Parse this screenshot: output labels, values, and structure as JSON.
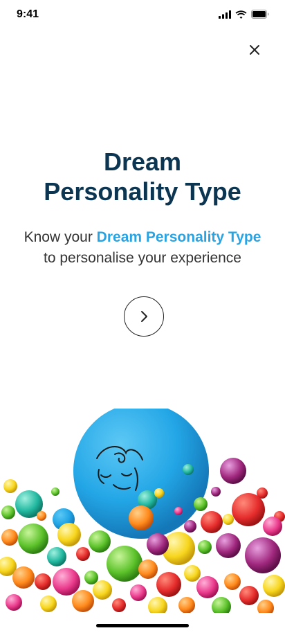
{
  "status_bar": {
    "time": "9:41"
  },
  "icons": {
    "close": "close-icon",
    "next": "chevron-right-icon",
    "signal": "signal-icon",
    "wifi": "wifi-icon",
    "battery": "battery-icon"
  },
  "title": {
    "line1": "Dream",
    "line2": "Personality Type"
  },
  "subtitle": {
    "prefix": "Know your ",
    "highlight": "Dream Personality Type",
    "line2": "to personalise your experience"
  },
  "colors": {
    "title": "#0b3550",
    "highlight": "#2aa3e2",
    "sphere": "#2ab0e8"
  }
}
